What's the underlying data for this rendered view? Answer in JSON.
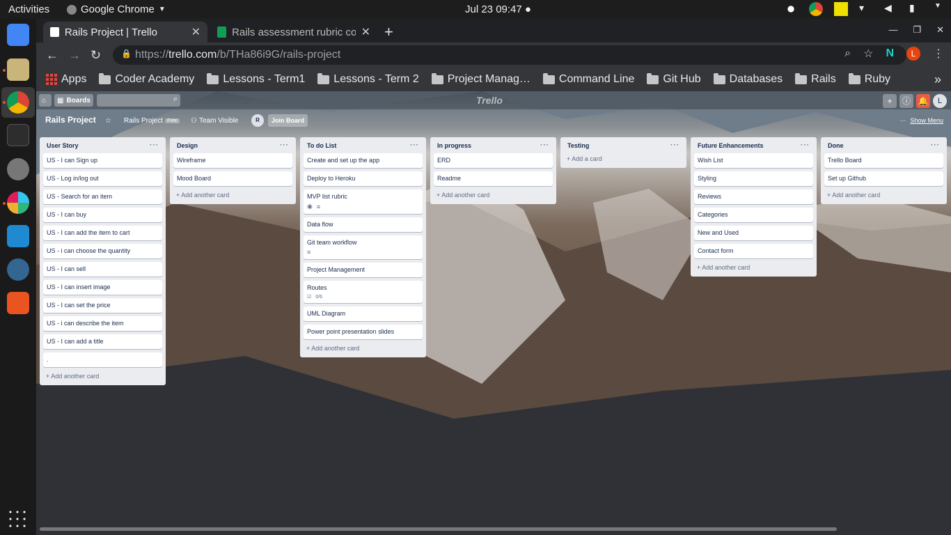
{
  "system": {
    "activities": "Activities",
    "app_name": "Google Chrome",
    "clock": "Jul 23  09:47"
  },
  "browser": {
    "tabs": [
      {
        "title": "Rails Project | Trello"
      },
      {
        "title": "Rails assessment rubric co"
      }
    ],
    "url_prefix": "https://",
    "url_host": "trello.com",
    "url_path": "/b/THa86i9G/rails-project",
    "profile_initial": "L",
    "bookmarks": [
      "Apps",
      "Coder Academy",
      "Lessons - Term1",
      "Lessons - Term 2",
      "Project Manag…",
      "Command Line",
      "Git Hub",
      "Databases",
      "Rails",
      "Ruby"
    ]
  },
  "trello": {
    "header": {
      "boards_label": "Boards",
      "logo": "Trello",
      "user_initial": "L"
    },
    "board": {
      "name": "Rails Project",
      "team_name": "Rails Project",
      "team_badge": "Free",
      "visibility": "Team Visible",
      "member_initial": "R",
      "join_label": "Join Board",
      "show_menu": "Show Menu"
    },
    "add_card_label": "Add another card",
    "add_first_card_label": "Add a card",
    "lists": [
      {
        "title": "User Story",
        "cards": [
          {
            "title": "US - I can Sign up"
          },
          {
            "title": "US - Log in/log out"
          },
          {
            "title": "US - Search for an item"
          },
          {
            "title": "US - I can buy"
          },
          {
            "title": "US - I can add the item to cart"
          },
          {
            "title": "US - i can choose the quantity"
          },
          {
            "title": "US - I can sell"
          },
          {
            "title": "US - I can insert image"
          },
          {
            "title": "US - I can set the price"
          },
          {
            "title": "US - i can describe the item"
          },
          {
            "title": "US - I can add a title"
          },
          {
            "title": "."
          }
        ]
      },
      {
        "title": "Design",
        "cards": [
          {
            "title": "Wireframe"
          },
          {
            "title": "Mood Board"
          }
        ]
      },
      {
        "title": "To do List",
        "cards": [
          {
            "title": "Create and set up the app"
          },
          {
            "title": "Deploy to Heroku"
          },
          {
            "title": "MVP list rubric",
            "badges": [
              "watch",
              "description"
            ]
          },
          {
            "title": "Data flow"
          },
          {
            "title": "Git team workflow",
            "badges": [
              "description"
            ]
          },
          {
            "title": "Project Management"
          },
          {
            "title": "Routes",
            "checklist": "0/6"
          },
          {
            "title": "UML Diagram"
          },
          {
            "title": "Power point presentation slides"
          }
        ]
      },
      {
        "title": "In progress",
        "cards": [
          {
            "title": "ERD"
          },
          {
            "title": "Readme"
          }
        ]
      },
      {
        "title": "Testing",
        "cards": []
      },
      {
        "title": "Future Enhancements",
        "cards": [
          {
            "title": "Wish List"
          },
          {
            "title": "Styling"
          },
          {
            "title": "Reviews"
          },
          {
            "title": "Categories"
          },
          {
            "title": "New and Used"
          },
          {
            "title": "Contact form"
          }
        ]
      },
      {
        "title": "Done",
        "cards": [
          {
            "title": "Trello Board"
          },
          {
            "title": "Set up Github"
          }
        ]
      }
    ]
  }
}
